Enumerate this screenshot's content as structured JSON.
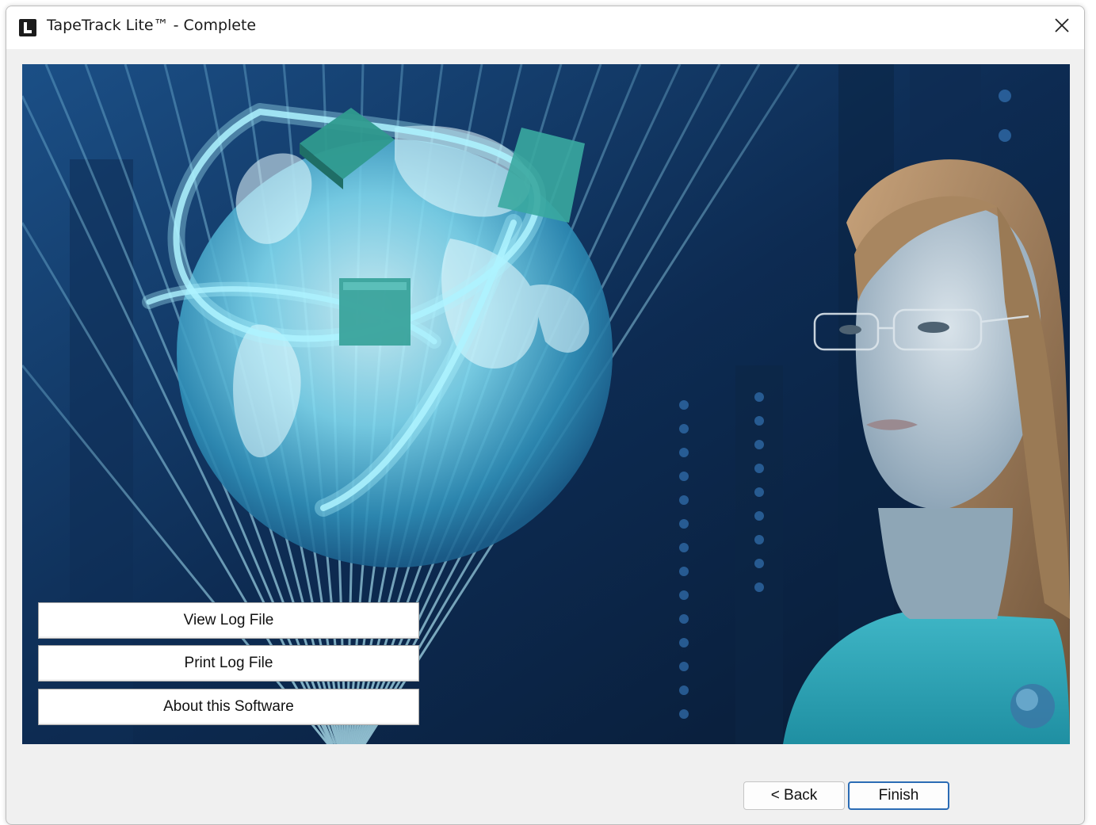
{
  "window": {
    "title": "TapeTrack Lite™ - Complete",
    "icon": "tapetrack-logo-icon",
    "close_icon": "close-icon"
  },
  "actions": {
    "view_log": "View Log File",
    "print_log": "Print Log File",
    "about": "About this Software"
  },
  "footer": {
    "back_label": "< Back",
    "finish_label": "Finish"
  },
  "colors": {
    "accent": "#2b6cb5",
    "hero_bg": "#0a1f3c",
    "glow": "#7fe0ff"
  }
}
